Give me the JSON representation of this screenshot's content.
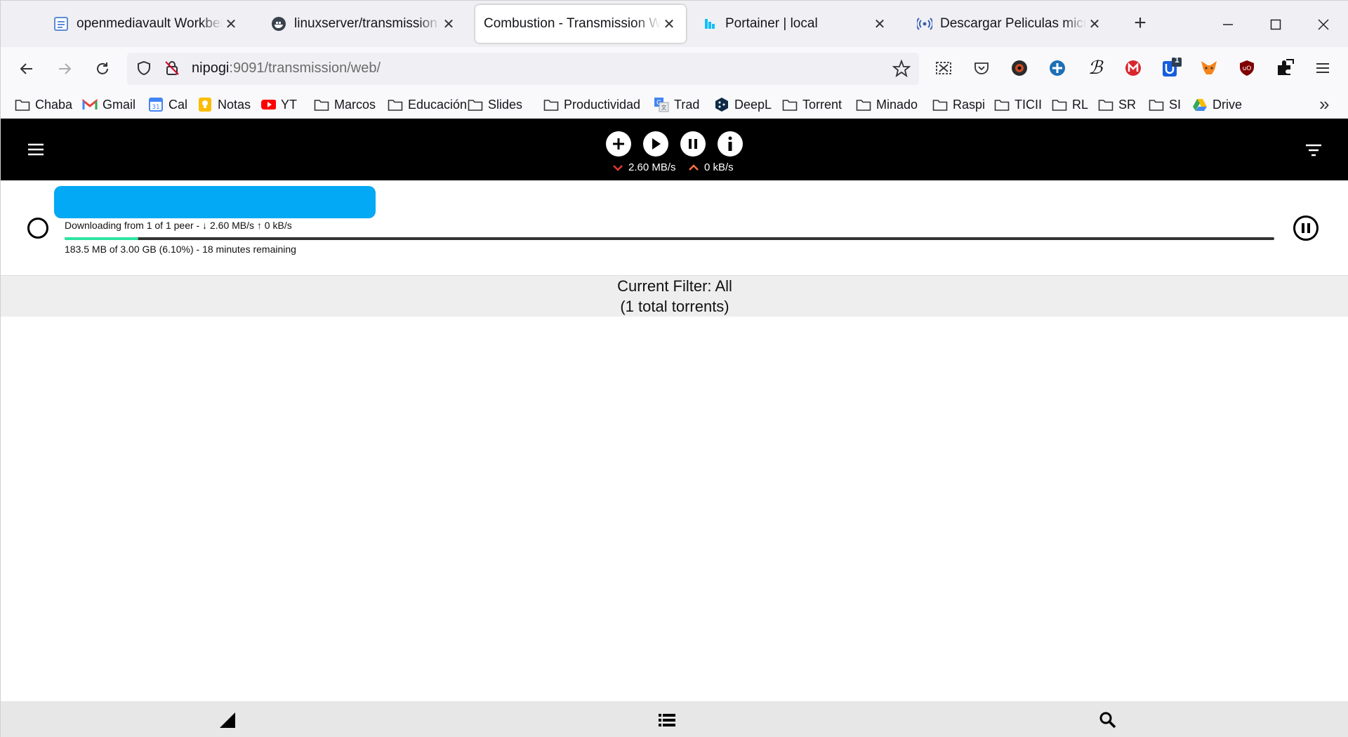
{
  "browser": {
    "tabs": [
      {
        "title": "openmediavault Workbench",
        "icon": "document-icon",
        "active": false
      },
      {
        "title": "linuxserver/transmission - D",
        "icon": "docker-icon",
        "active": false
      },
      {
        "title": "Combustion - Transmission Web",
        "icon": "",
        "active": true
      },
      {
        "title": "Portainer | local",
        "icon": "portainer-icon",
        "active": false
      },
      {
        "title": "Descargar Peliculas microHD",
        "icon": "broadcast-icon",
        "active": false
      }
    ],
    "url": {
      "host": "nipogi",
      "path": ":9091/transmission/web/"
    },
    "extensions_badge": "1",
    "bookmarks": [
      {
        "label": "Chaba",
        "icon": "folder-icon"
      },
      {
        "label": "Gmail",
        "icon": "gmail-icon"
      },
      {
        "label": "Cal",
        "icon": "calendar-icon"
      },
      {
        "label": "Notas",
        "icon": "keep-icon"
      },
      {
        "label": "YT",
        "icon": "youtube-icon"
      },
      {
        "label": "Marcos",
        "icon": "folder-icon"
      },
      {
        "label": "Educación",
        "icon": "folder-icon"
      },
      {
        "label": "Slides",
        "icon": "folder-icon"
      },
      {
        "label": "Productividad",
        "icon": "folder-icon"
      },
      {
        "label": "Trad",
        "icon": "translate-icon"
      },
      {
        "label": "DeepL",
        "icon": "deepl-icon"
      },
      {
        "label": "Torrent",
        "icon": "folder-icon"
      },
      {
        "label": "Minado",
        "icon": "folder-icon"
      },
      {
        "label": "Raspi",
        "icon": "folder-icon"
      },
      {
        "label": "TICII",
        "icon": "folder-icon"
      },
      {
        "label": "RL",
        "icon": "folder-icon"
      },
      {
        "label": "SR",
        "icon": "folder-icon"
      },
      {
        "label": "SI",
        "icon": "folder-icon"
      },
      {
        "label": "Drive",
        "icon": "drive-icon"
      }
    ]
  },
  "app": {
    "download_speed": "2.60 MB/s",
    "upload_speed": "0 kB/s",
    "torrent": {
      "name": "",
      "peer_status": "Downloading from 1 of 1 peer - ↓ 2.60 MB/s ↑ 0 kB/s",
      "size_status": "183.5 MB of 3.00 GB (6.10%) - 18 minutes remaining",
      "progress": 0.061
    },
    "filter": {
      "line1": "Current Filter: All",
      "line2": "(1 total torrents)"
    }
  },
  "colors": {
    "accent": "#03a9f4",
    "progress": "#2de3a0",
    "down_arrow": "#e53935",
    "up_arrow": "#ff7043",
    "header_bg": "#000000"
  }
}
